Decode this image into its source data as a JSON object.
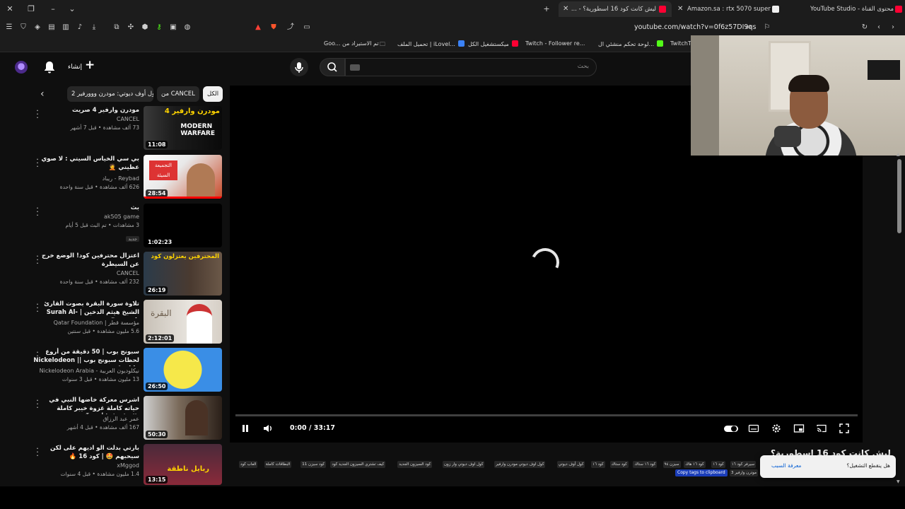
{
  "tabs": [
    {
      "label": "ليش كانت كود 16 اسطورية؟ - ...",
      "active": true,
      "favicon_color": "#ff0033"
    },
    {
      "label": "Amazon.sa : rtx 5070 super",
      "active": false,
      "favicon_color": "#f0f0f0"
    },
    {
      "label": "محتوى القناة - YouTube Studio",
      "active": false,
      "favicon_color": "#ff0033"
    }
  ],
  "url": "youtube.com/watch?v=0f6z57DI9qs",
  "bookmarks": [
    {
      "label": "Goo... تم الاستيراد من",
      "color": "#cccccc"
    },
    {
      "label": "تحميل الملف | iLovel...",
      "color": "#3b82f6"
    },
    {
      "label": "ميكستشغيل الكل",
      "color": "#ff0033"
    },
    {
      "label": "Twitch - Follower re...",
      "color": "#9146ff"
    },
    {
      "label": "لوحة تحكم منشئي ال...",
      "color": "#53fc18"
    },
    {
      "label": "TwitchT...",
      "color": "#9146ff"
    }
  ],
  "masthead": {
    "create_label": "إنشاء",
    "search_placeholder": "بحث"
  },
  "chips": [
    {
      "label": "الكل",
      "selected": true
    },
    {
      "label": "من CANCEL",
      "selected": false
    },
    {
      "label": "كول أوف ديوتي: مودرن ووورفير 2",
      "selected": false
    }
  ],
  "videos": [
    {
      "title": "مودرن وارفير 4 صريت",
      "channel": "CANCEL",
      "meta": "73 ألف مشاهدة • قبل 7 أشهر",
      "duration": "11:08",
      "progress": 0,
      "badge": ""
    },
    {
      "title": "بي سي الخياس السيتي : لا صوي عظيني 🤦",
      "channel": "Reybad - ريباد",
      "meta": "626 ألف مشاهدة • قبل سنة واحدة",
      "duration": "28:54",
      "progress": 1.0,
      "badge": ""
    },
    {
      "title": "بث",
      "channel": "ak505 game",
      "meta": "3 مشاهدات • تم البث قبل 5 أيام",
      "duration": "1:02:23",
      "progress": 0,
      "badge": "جديد"
    },
    {
      "title": "اعتزال محترفين كود! الوضع خرج عن السيطرة",
      "channel": "CANCEL",
      "meta": "232 ألف مشاهدة • قبل سنة واحدة",
      "duration": "26:19",
      "progress": 0,
      "badge": ""
    },
    {
      "title": "تلاوة سورة البقرة بصوت القارئ الشيخ هيثم الدخين | Surah Al-Baqarah ...",
      "channel": "مؤسسة قطر | Qatar Foundation",
      "meta": "5.6 مليون مشاهدة • قبل سنتين",
      "duration": "2:12:01",
      "progress": 0,
      "badge": ""
    },
    {
      "title": "سبونج بوب | 50 دقيقة من أروع لحظات سبونج بوب || Nickelodeon Arabia",
      "channel": "نيكلوديون العربية - Nickelodeon Arabia",
      "meta": "13 مليون مشاهدة • قبل 3 سنوات",
      "duration": "26:50",
      "progress": 0,
      "badge": ""
    },
    {
      "title": "اشرس معركة خاضها النبي في حياته كاملة غزوة خيبر كاملة بالتفاصيل | أنس آكشن",
      "channel": "عمر عبد الرزاق",
      "meta": "167 ألف مشاهدة • قبل 4 أشهر",
      "duration": "50:30",
      "progress": 0,
      "badge": ""
    },
    {
      "title": "بارتي بدلت الو اديهم على لكن سيحبهم 🤩 | كود 16 🔥",
      "channel": "xMggod",
      "meta": "1.4 مليون مشاهدة • قبل 4 سنوات",
      "duration": "13:15",
      "progress": 0,
      "badge": ""
    }
  ],
  "player": {
    "time_current": "0:00",
    "time_total": "33:17",
    "progress": 0.0
  },
  "video_title": "ليش كانت كود 16 اسطورية؟",
  "tags": [
    "العاب كود",
    "البطاقات كاملة",
    "كود سيزن 11",
    "كيف تشتري السيزون الجديد كود",
    "كود السيزون الجديد",
    "كول اوف ديوتي وار زون",
    "كول اوف ديوتي مودرن وارفير",
    "كول أوف ديوتي",
    "كود ١٦",
    "كود ستاك",
    "كود ١٦ ستاك",
    "سيزن ٩٤",
    "كود ١٦ هاك",
    "كود ١٦",
    "سيرفر كود ١٦",
    "سيرفر كود"
  ],
  "copy_tags_label": "Copy tags to clipboard",
  "extra_tag": "مودرن وارفير 3",
  "toast": {
    "question": "هل ينقطع التشغيل؟",
    "link": "معرفة السبب"
  },
  "colors": {
    "background": "#0f0f0f",
    "progress_red": "#ff0000",
    "link_blue": "#065fd4"
  }
}
